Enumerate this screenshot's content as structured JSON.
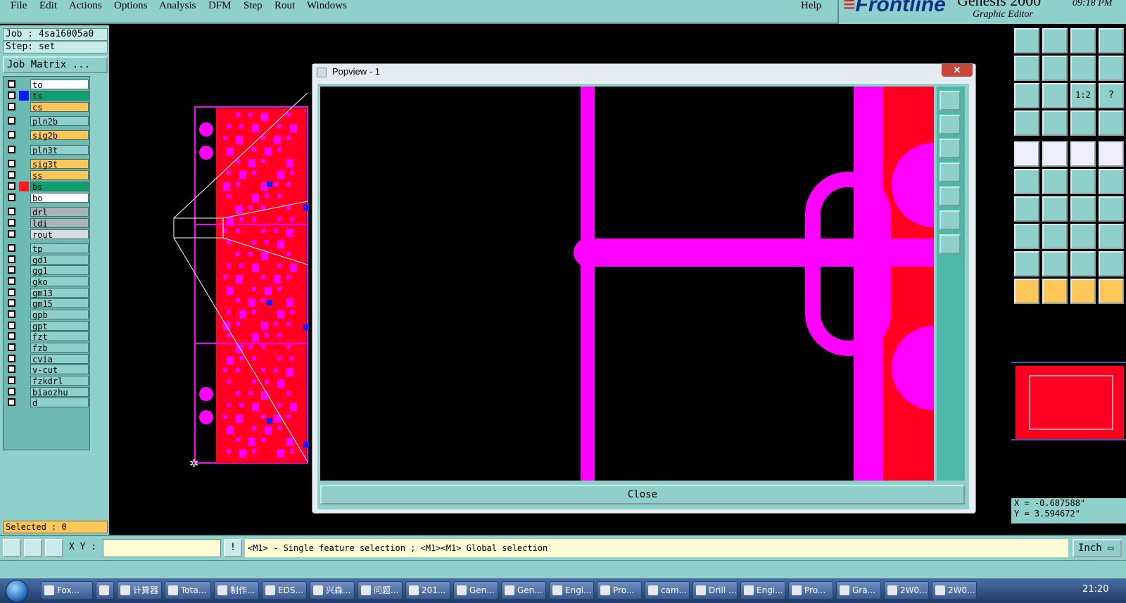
{
  "menubar": {
    "items": [
      "File",
      "Edit",
      "Actions",
      "Options",
      "Analysis",
      "DFM",
      "Step",
      "Rout",
      "Windows"
    ],
    "help": "Help"
  },
  "brand": {
    "logo": "Frontline",
    "product": "Genesis 2000",
    "subtitle": "Graphic Editor",
    "clock": "09:18 PM"
  },
  "left": {
    "job": "Job : 4sa16005a0",
    "step": "Step: set",
    "job_matrix": "Job Matrix ...",
    "selected": "Selected : 0",
    "layers": [
      {
        "name": "to",
        "color": "#ffffff",
        "indicator": ""
      },
      {
        "name": "ts",
        "color": "#10a070",
        "indicator": "#0a1aff"
      },
      {
        "name": "cs",
        "color": "#ffc65a",
        "indicator": ""
      },
      {
        "name": "pln2b",
        "color": "#8fd0cc",
        "indicator": ""
      },
      {
        "name": "sig2b",
        "color": "#ffc65a",
        "indicator": ""
      },
      {
        "name": "pln3t",
        "color": "#8fd0cc",
        "indicator": ""
      },
      {
        "name": "sig3t",
        "color": "#ffc65a",
        "indicator": ""
      },
      {
        "name": "ss",
        "color": "#ffc65a",
        "indicator": ""
      },
      {
        "name": "bs",
        "color": "#10a070",
        "indicator": "#ff1a1a"
      },
      {
        "name": "bo",
        "color": "#ffffff",
        "indicator": ""
      },
      {
        "name": "drl",
        "color": "#a9b4b8",
        "indicator": ""
      },
      {
        "name": "ldi",
        "color": "#a9b4b8",
        "indicator": ""
      },
      {
        "name": "rout",
        "color": "#d9dde0",
        "indicator": ""
      },
      {
        "name": "tp",
        "color": "#8fd0cc",
        "indicator": ""
      },
      {
        "name": "gd1",
        "color": "#8fd0cc",
        "indicator": ""
      },
      {
        "name": "gg1",
        "color": "#8fd0cc",
        "indicator": ""
      },
      {
        "name": "gko",
        "color": "#8fd0cc",
        "indicator": ""
      },
      {
        "name": "gm13",
        "color": "#8fd0cc",
        "indicator": ""
      },
      {
        "name": "gm15",
        "color": "#8fd0cc",
        "indicator": ""
      },
      {
        "name": "gpb",
        "color": "#8fd0cc",
        "indicator": ""
      },
      {
        "name": "gpt",
        "color": "#8fd0cc",
        "indicator": ""
      },
      {
        "name": "fzt",
        "color": "#8fd0cc",
        "indicator": ""
      },
      {
        "name": "fzb",
        "color": "#8fd0cc",
        "indicator": ""
      },
      {
        "name": "cvia",
        "color": "#8fd0cc",
        "indicator": ""
      },
      {
        "name": "v-cut",
        "color": "#8fd0cc",
        "indicator": ""
      },
      {
        "name": "fzkdrl",
        "color": "#8fd0cc",
        "indicator": ""
      },
      {
        "name": "biaozhu",
        "color": "#8fd0cc",
        "indicator": ""
      },
      {
        "name": "d",
        "color": "#8fd0cc",
        "indicator": ""
      }
    ]
  },
  "popview": {
    "title": "Popview - 1",
    "close_x": "✕",
    "close_label": "Close"
  },
  "tools": {
    "icons": [
      "zoom-in-icon",
      "zoom-out-icon",
      "home-icon",
      "split-view-icon",
      "pan-left-icon",
      "pan-right-icon",
      "undo-view-icon",
      "redraw-icon",
      "fit-icon",
      "center-icon",
      "one-to-one-icon",
      "help-icon",
      "measure-tool-icon",
      "grid-icon",
      "net-red-icon",
      "net-red-2-icon",
      "pad-add-icon",
      "polygon-icon",
      "ruler-icon",
      "circle-select-icon",
      "connect-icon",
      "delete-node-icon",
      "move-node-icon",
      "angle-node-icon",
      "line-draw-icon",
      "line-edit-icon",
      "arc-icon",
      "fillet-icon",
      "snap-icon",
      "line-h-icon",
      "dimension-icon",
      "pad-array-icon",
      "triangle-1-icon",
      "triangle-2-icon",
      "triangle-3-icon",
      "triangle-4-icon",
      "pointer-icon",
      "pointer-yellow-icon",
      "pointer-circle-icon",
      "route-icon"
    ],
    "one_to_one": "1:2",
    "help": "?"
  },
  "coords": {
    "x": "X = -0.687588\"",
    "y": "Y = 3.594672\""
  },
  "command": {
    "xy_label": "X Y :",
    "xy_value": "",
    "warn": "!",
    "message": "<M1> - Single feature selection ; <M1><M1> Global selection",
    "unit": "Inch"
  },
  "taskbar": {
    "items": [
      "Fox...",
      "",
      "计算器",
      "Tota...",
      "制作...",
      "EDS...",
      "兴森...",
      "问题...",
      "201...",
      "Gen...",
      "Gen...",
      "Engi...",
      "Pro...",
      "cam...",
      "Drill ...",
      "Engi...",
      "Pro...",
      "Gra...",
      "2W0...",
      "2W0..."
    ],
    "time": "21:20"
  },
  "colors": {
    "panel": "#8fd0cc",
    "board": "#ff0022",
    "copper": "#ff00ff",
    "accent": "#ffc65a"
  }
}
